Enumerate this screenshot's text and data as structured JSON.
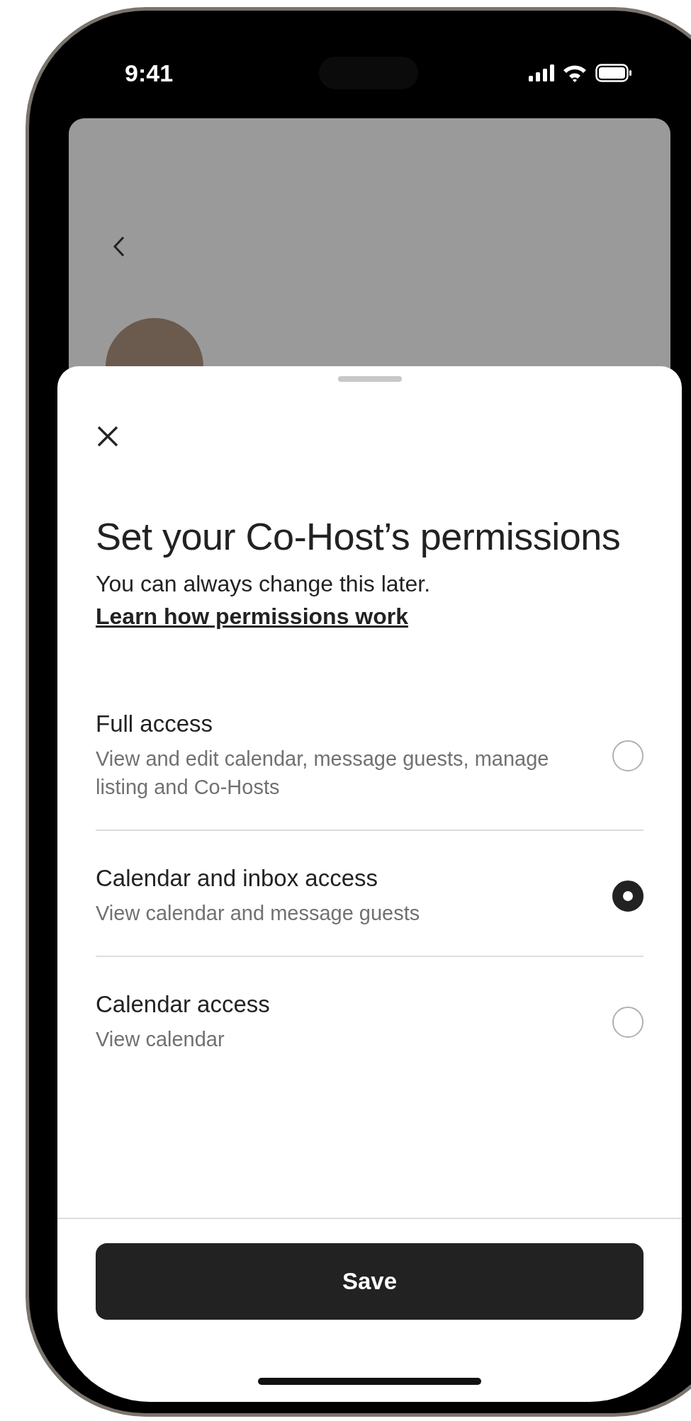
{
  "status_bar": {
    "time": "9:41"
  },
  "sheet": {
    "title": "Set your Co-Host’s permissions",
    "subtitle": "You can always change this later.",
    "link": "Learn how permissions work"
  },
  "options": [
    {
      "title": "Full access",
      "description": "View and edit calendar, message guests, manage listing and Co-Hosts",
      "selected": false
    },
    {
      "title": "Calendar and inbox access",
      "description": "View calendar and message guests",
      "selected": true
    },
    {
      "title": "Calendar access",
      "description": "View calendar",
      "selected": false
    }
  ],
  "save_button": "Save"
}
